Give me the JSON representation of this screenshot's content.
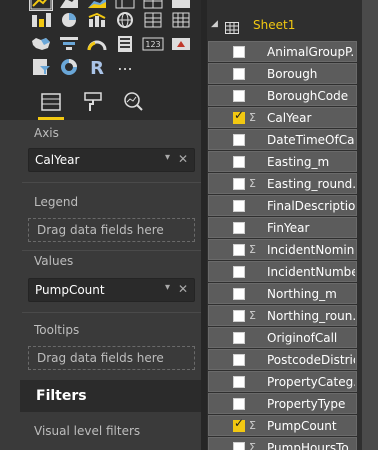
{
  "visualizations": {
    "gallery_icons": [
      "line-chart-icon",
      "area-chart-icon",
      "stacked-area-icon",
      "table-icon",
      "pie-chart-icon",
      "line-clustered-column-icon",
      "globe-map-icon",
      "matrix-icon",
      "donut-chart-icon",
      "filled-map-icon",
      "funnel-icon",
      "gauge-icon",
      "multi-row-card-icon",
      "card-icon",
      "kpi-icon",
      "slicer-icon",
      "donut-icon",
      "r-visual-icon",
      "more-visuals-icon"
    ],
    "r_label": "R",
    "more_label": "...",
    "tabs": [
      "fields-tab-icon",
      "format-paint-icon",
      "analytics-icon"
    ],
    "wells": {
      "axis_label": "Axis",
      "axis_field": "CalYear",
      "legend_label": "Legend",
      "legend_placeholder": "Drag data fields here",
      "values_label": "Values",
      "values_field": "PumpCount",
      "tooltips_label": "Tooltips",
      "tooltips_placeholder": "Drag data fields here"
    },
    "pill_chevron": "▾",
    "pill_remove": "✕",
    "filters_title": "Filters",
    "visual_level_filters": "Visual level filters"
  },
  "fields_pane": {
    "caret": "◢",
    "sheet_name": "Sheet1",
    "sigma": "Σ",
    "checkmark": "✓",
    "fields": [
      {
        "name": "AnimalGroupP...",
        "sigma": false,
        "checked": false
      },
      {
        "name": "Borough",
        "sigma": false,
        "checked": false
      },
      {
        "name": "BoroughCode",
        "sigma": false,
        "checked": false
      },
      {
        "name": "CalYear",
        "sigma": true,
        "checked": true
      },
      {
        "name": "DateTimeOfCall",
        "sigma": false,
        "checked": false
      },
      {
        "name": "Easting_m",
        "sigma": false,
        "checked": false
      },
      {
        "name": "Easting_round...",
        "sigma": true,
        "checked": false
      },
      {
        "name": "FinalDescription",
        "sigma": false,
        "checked": false
      },
      {
        "name": "FinYear",
        "sigma": false,
        "checked": false
      },
      {
        "name": "IncidentNomin...",
        "sigma": true,
        "checked": false
      },
      {
        "name": "IncidentNumber",
        "sigma": false,
        "checked": false
      },
      {
        "name": "Northing_m",
        "sigma": false,
        "checked": false
      },
      {
        "name": "Northing_roun...",
        "sigma": true,
        "checked": false
      },
      {
        "name": "OriginofCall",
        "sigma": false,
        "checked": false
      },
      {
        "name": "PostcodeDistrict",
        "sigma": false,
        "checked": false
      },
      {
        "name": "PropertyCateg...",
        "sigma": false,
        "checked": false
      },
      {
        "name": "PropertyType",
        "sigma": false,
        "checked": false
      },
      {
        "name": "PumpCount",
        "sigma": true,
        "checked": true
      },
      {
        "name": "PumpHoursTo...",
        "sigma": true,
        "checked": false
      }
    ]
  },
  "colors": {
    "accent": "#f2c811",
    "pane_bg": "#3a3a3a",
    "field_row_bg": "#5c5c5c"
  }
}
